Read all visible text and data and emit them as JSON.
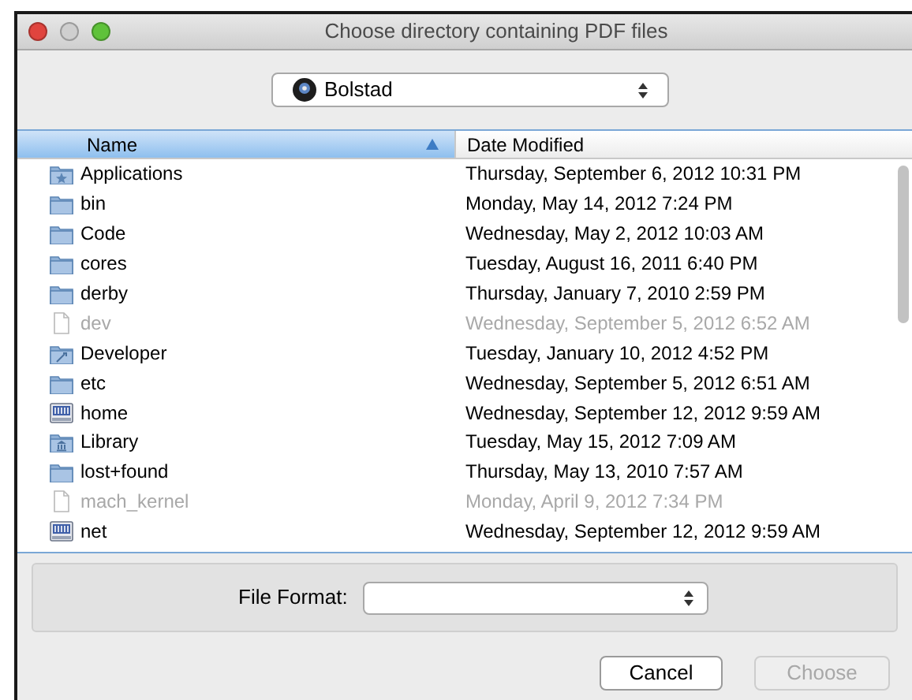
{
  "window": {
    "title": "Choose directory containing PDF files",
    "controls": [
      {
        "kind": "close",
        "disabled": false
      },
      {
        "kind": "minimize",
        "disabled": true
      },
      {
        "kind": "zoom",
        "disabled": false
      }
    ]
  },
  "location_popup": {
    "value": "Bolstad"
  },
  "table": {
    "columns": [
      {
        "label": "Name",
        "selected": true,
        "sorted": true
      },
      {
        "label": "Date Modified",
        "selected": false,
        "sorted": false
      }
    ],
    "rows": [
      {
        "name": "Applications",
        "date": "Thursday, September 6, 2012 10:31 PM",
        "kind": "applications",
        "disabled": false
      },
      {
        "name": "bin",
        "date": "Monday, May 14, 2012 7:24 PM",
        "kind": "folder",
        "disabled": false
      },
      {
        "name": "Code",
        "date": "Wednesday, May 2, 2012 10:03 AM",
        "kind": "folder",
        "disabled": false
      },
      {
        "name": "cores",
        "date": "Tuesday, August 16, 2011 6:40 PM",
        "kind": "folder",
        "disabled": false
      },
      {
        "name": "derby",
        "date": "Thursday, January 7, 2010 2:59 PM",
        "kind": "folder",
        "disabled": false
      },
      {
        "name": "dev",
        "date": "Wednesday, September 5, 2012 6:52 AM",
        "kind": "document",
        "disabled": true
      },
      {
        "name": "Developer",
        "date": "Tuesday, January 10, 2012 4:52 PM",
        "kind": "developer",
        "disabled": false
      },
      {
        "name": "etc",
        "date": "Wednesday, September 5, 2012 6:51 AM",
        "kind": "folder",
        "disabled": false
      },
      {
        "name": "home",
        "date": "Wednesday, September 12, 2012 9:59 AM",
        "kind": "network",
        "disabled": false
      },
      {
        "name": "Library",
        "date": "Tuesday, May 15, 2012 7:09 AM",
        "kind": "library",
        "disabled": false
      },
      {
        "name": "lost+found",
        "date": "Thursday, May 13, 2010 7:57 AM",
        "kind": "folder",
        "disabled": false
      },
      {
        "name": "mach_kernel",
        "date": "Monday, April 9, 2012 7:34 PM",
        "kind": "document",
        "disabled": true
      },
      {
        "name": "net",
        "date": "Wednesday, September 12, 2012 9:59 AM",
        "kind": "network",
        "disabled": false
      }
    ]
  },
  "file_format": {
    "label": "File Format:"
  },
  "buttons": [
    {
      "label": "Cancel",
      "disabled": false
    },
    {
      "label": "Choose",
      "disabled": true
    }
  ]
}
